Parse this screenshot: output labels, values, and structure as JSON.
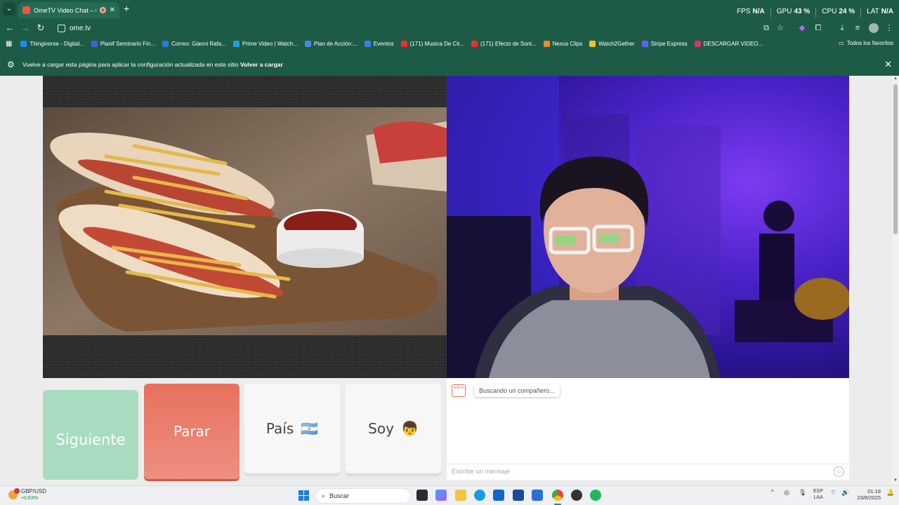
{
  "browser": {
    "tab": {
      "title": "OmeTV Video Chat – Ome",
      "close": "✕"
    },
    "new_tab": "+",
    "perf": [
      {
        "label": "FPS",
        "value": "N/A"
      },
      {
        "label": "GPU",
        "value": "43 %"
      },
      {
        "label": "CPU",
        "value": "24 %"
      },
      {
        "label": "LAT",
        "value": "N/A"
      }
    ],
    "address": "ome.tv",
    "bookmarks": [
      {
        "label": "Thingiverse - Digital...",
        "color": "#1a8cff"
      },
      {
        "label": "Planif Seminario Fin...",
        "color": "#3b63d6"
      },
      {
        "label": "Correo: Gianni Rafa...",
        "color": "#2b7bd8"
      },
      {
        "label": "Prime Video | Watch...",
        "color": "#1aa0e0"
      },
      {
        "label": "Plan de Acción:...",
        "color": "#4a86e8"
      },
      {
        "label": "Eventos",
        "color": "#3d7df5"
      },
      {
        "label": "(171) Musica De Cir...",
        "color": "#ff2a2a"
      },
      {
        "label": "(171) Efecto de Soni...",
        "color": "#ff2a2a"
      },
      {
        "label": "Nexus Clips",
        "color": "#e88c2c"
      },
      {
        "label": "Watch2Gether",
        "color": "#f0c419"
      },
      {
        "label": "Stripe Express",
        "color": "#635bff"
      },
      {
        "label": "DESCARGAR VIDEO...",
        "color": "#d6336c"
      }
    ],
    "all_bookmarks": "Todos los favoritos",
    "infobar": {
      "message": "Vuelve a cargar esta página para aplicar la configuración actualizada en este sitio",
      "action": "Volver a cargar"
    }
  },
  "ometv": {
    "buttons": {
      "next": "Siguiente",
      "stop": "Parar",
      "country": "País",
      "gender": "Soy",
      "country_flag": "🇦🇷",
      "gender_emoji": "👦"
    },
    "chat": {
      "logo": "ome tv",
      "status": "Buscando un compañero...",
      "placeholder": "Escribe un mensaje"
    }
  },
  "taskbar": {
    "stock": {
      "name": "GBP/USD",
      "change": "+0.63%"
    },
    "search": "Buscar",
    "lang": [
      "ESP",
      "LAA"
    ],
    "time": "01:18",
    "date": "23/8/2025"
  },
  "colors": {
    "chrome": "#1e5b46",
    "next_button": "#a8dcc0",
    "stop_button": "#e8705e",
    "accent": "#e86c5c"
  }
}
